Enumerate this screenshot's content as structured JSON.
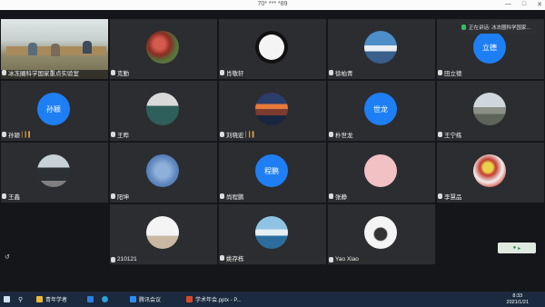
{
  "window": {
    "title": "70* *** *89",
    "controls": [
      "—",
      "□",
      "✕"
    ]
  },
  "notification": {
    "text": "正在讲话: 冰冻圈科学国家..."
  },
  "participants": [
    {
      "name": "冰冻圈科学国家重点实验室",
      "type": "video"
    },
    {
      "name": "克勤",
      "type": "avatar",
      "style": "av-red"
    },
    {
      "name": "肖敬轩",
      "type": "avatar",
      "style": "av-panda"
    },
    {
      "name": "徐柏青",
      "type": "avatar",
      "style": "av-mount"
    },
    {
      "name": "田立德",
      "type": "initials",
      "initials": "立德"
    },
    {
      "name": "孙颖",
      "type": "initials",
      "initials": "孙颖",
      "signal": true
    },
    {
      "name": "王晔",
      "type": "avatar",
      "style": "av-kid"
    },
    {
      "name": "刘晓宏",
      "type": "avatar",
      "style": "av-sunset",
      "signal": true
    },
    {
      "name": "朴世龙",
      "type": "initials",
      "initials": "世龙"
    },
    {
      "name": "王宁练",
      "type": "avatar",
      "style": "av-beach"
    },
    {
      "name": "王鑫",
      "type": "avatar",
      "style": "av-car"
    },
    {
      "name": "阳坤",
      "type": "avatar",
      "style": "av-cracked"
    },
    {
      "name": "尚程鹏",
      "type": "initials",
      "initials": "程鹏"
    },
    {
      "name": "张静",
      "type": "avatar",
      "style": "av-pink"
    },
    {
      "name": "李慧品",
      "type": "avatar",
      "style": "av-flowers"
    },
    {
      "name": "210121",
      "type": "avatar",
      "style": "av-speaker"
    },
    {
      "name": "姚存栋",
      "type": "avatar",
      "style": "av-ocean"
    },
    {
      "name": "Yao Xiao",
      "type": "avatar",
      "style": "av-penguin"
    }
  ],
  "side_button": {
    "label": "▸"
  },
  "taskbar": {
    "apps": [
      {
        "label": "青年学者",
        "color": "#e8b93a"
      },
      {
        "label": "",
        "color": "#2f7de1"
      },
      {
        "label": "",
        "color": "#2fa0d8"
      },
      {
        "label": "腾讯会议",
        "color": "#2f8cf0"
      },
      {
        "label": "学术年会.pptx - P...",
        "color": "#d24a2c"
      }
    ],
    "time": "8:33",
    "date": "2021/1/21"
  }
}
